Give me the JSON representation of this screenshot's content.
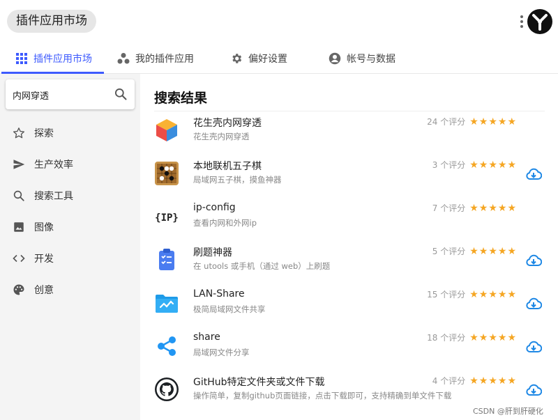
{
  "app": {
    "title": "插件应用市场"
  },
  "tabs": [
    {
      "label": "插件应用市场",
      "icon": "grid-icon",
      "active": true
    },
    {
      "label": "我的插件应用",
      "icon": "dots-cluster-icon"
    },
    {
      "label": "偏好设置",
      "icon": "gear-icon"
    },
    {
      "label": "帐号与数据",
      "icon": "account-icon"
    }
  ],
  "search": {
    "value": "内网穿透",
    "placeholder": ""
  },
  "sidebar": {
    "items": [
      {
        "label": "探索",
        "icon": "star-outline-icon"
      },
      {
        "label": "生产效率",
        "icon": "send-icon"
      },
      {
        "label": "搜索工具",
        "icon": "search-icon"
      },
      {
        "label": "图像",
        "icon": "image-icon"
      },
      {
        "label": "开发",
        "icon": "code-icon"
      },
      {
        "label": "创意",
        "icon": "palette-icon"
      }
    ]
  },
  "main": {
    "title": "搜索结果",
    "plugins": [
      {
        "name": "花生壳内网穿透",
        "desc": "花生壳内网穿透",
        "rating": "24 个评分",
        "stars": "★★★★★",
        "download": false,
        "icon": "cube-icon"
      },
      {
        "name": "本地联机五子棋",
        "desc": "局域网五子棋，摸鱼神器",
        "rating": "3 个评分",
        "stars": "★★★★★",
        "download": true,
        "icon": "gomoku-board-icon"
      },
      {
        "name": "ip-config",
        "desc": "查看内网和外网ip",
        "rating": "7 个评分",
        "stars": "★★★★★",
        "download": false,
        "icon": "ip-text-icon",
        "icon_text": "{IP}"
      },
      {
        "name": "刷题神器",
        "desc": "在 utools 或手机（通过 web）上刷题",
        "rating": "5 个评分",
        "stars": "★★★★★",
        "download": true,
        "icon": "clipboard-check-icon"
      },
      {
        "name": "LAN-Share",
        "desc": "极简局域网文件共享",
        "rating": "15 个评分",
        "stars": "★★★★★",
        "download": true,
        "icon": "folder-share-icon"
      },
      {
        "name": "share",
        "desc": "局域网文件分享",
        "rating": "18 个评分",
        "stars": "★★★★★",
        "download": true,
        "icon": "share-icon"
      },
      {
        "name": "GitHub特定文件夹或文件下载",
        "desc": "操作简单，复制github页面链接，点击下载即可，支持精确到单文件下载",
        "rating": "4 个评分",
        "stars": "★★★★★",
        "download": true,
        "icon": "github-icon"
      }
    ]
  },
  "watermark": "CSDN @肝到肝硬化",
  "colors": {
    "accent": "#3d5afe",
    "star": "#f5a623",
    "download": "#1e88e5"
  }
}
